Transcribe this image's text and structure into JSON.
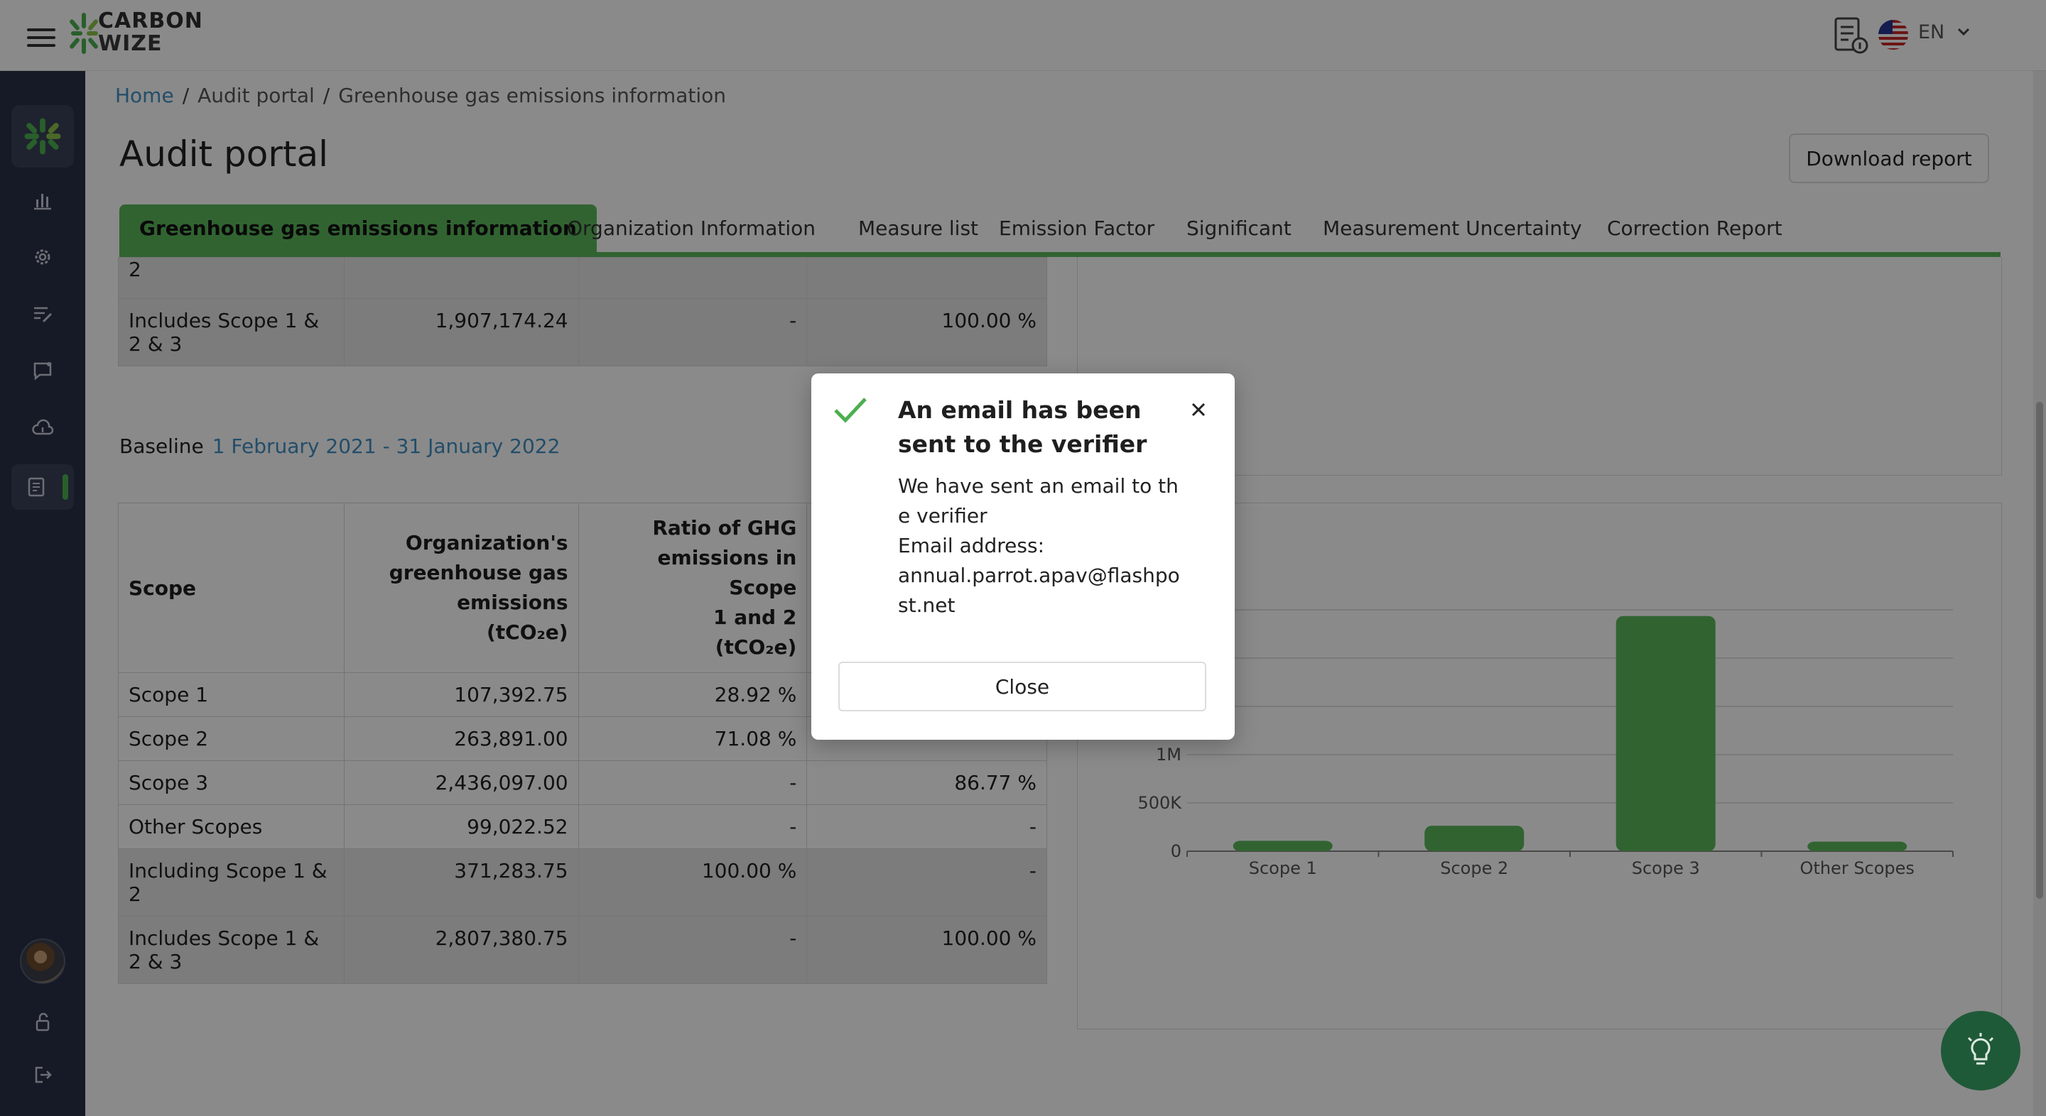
{
  "app": {
    "logo_line1": "CARBON",
    "logo_line2": "WIZE",
    "language": "EN"
  },
  "breadcrumb": {
    "home": "Home",
    "sep1": "/",
    "audit": "Audit portal",
    "sep2": "/",
    "current": "Greenhouse gas emissions information"
  },
  "page": {
    "title": "Audit portal",
    "download_label": "Download report"
  },
  "tabs": [
    {
      "label": "Greenhouse gas emissions information"
    },
    {
      "label": "Organization Information"
    },
    {
      "label": "Measure list"
    },
    {
      "label": "Emission Factor"
    },
    {
      "label": "Significant"
    },
    {
      "label": "Measurement Uncertainty"
    },
    {
      "label": "Correction Report"
    }
  ],
  "table_top": {
    "rows": [
      {
        "scope": "2",
        "emissions": "",
        "ratio12": "",
        "ratio123": ""
      },
      {
        "scope": "Includes Scope 1 & 2 & 3",
        "emissions": "1,907,174.24",
        "ratio12": "-",
        "ratio123": "100.00 %"
      }
    ]
  },
  "baseline": {
    "label": "Baseline",
    "range": "1 February 2021 - 31 January 2022"
  },
  "table_main": {
    "headers": {
      "scope": "Scope",
      "emissions_l1": "Organization's",
      "emissions_l2": "greenhouse gas",
      "emissions_l3": "emissions",
      "emissions_l4": "(tCO₂e)",
      "ratio_l1": "Ratio of GHG",
      "ratio_l2": "emissions in Scope",
      "ratio_l3": "1 and 2",
      "ratio_l4": "(tCO₂e)"
    },
    "rows": [
      {
        "scope": "Scope 1",
        "emissions": "107,392.75",
        "ratio12": "28.92 %",
        "ratio123": ""
      },
      {
        "scope": "Scope 2",
        "emissions": "263,891.00",
        "ratio12": "71.08 %",
        "ratio123": ""
      },
      {
        "scope": "Scope 3",
        "emissions": "2,436,097.00",
        "ratio12": "-",
        "ratio123": "86.77 %"
      },
      {
        "scope": "Other Scopes",
        "emissions": "99,022.52",
        "ratio12": "-",
        "ratio123": "-"
      },
      {
        "scope": "Including Scope 1 & 2",
        "emissions": "371,283.75",
        "ratio12": "100.00 %",
        "ratio123": "-"
      },
      {
        "scope": "Includes Scope 1 & 2 & 3",
        "emissions": "2,807,380.75",
        "ratio12": "-",
        "ratio123": "100.00 %"
      }
    ]
  },
  "chart_data": {
    "type": "bar",
    "categories": [
      "Scope 1",
      "Scope 2",
      "Scope 3",
      "Other Scopes"
    ],
    "values": [
      107392.75,
      263891.0,
      2436097.0,
      99022.52
    ],
    "y_ticks_visible": [
      "0",
      "500K",
      "1M"
    ],
    "ylim": [
      0,
      2500000
    ],
    "bar_color": "#5cb85c",
    "grid": true
  },
  "modal": {
    "title": "An email has been sent to the verifier",
    "line1": "We have sent an email to the verifier",
    "line2": "Email address:",
    "email": "annual.parrot.apav@flashpost.net",
    "close_label": "Close"
  },
  "colors": {
    "accent": "#5cb85c",
    "link": "#3f8fc4",
    "sidebar": "#2a3146"
  }
}
